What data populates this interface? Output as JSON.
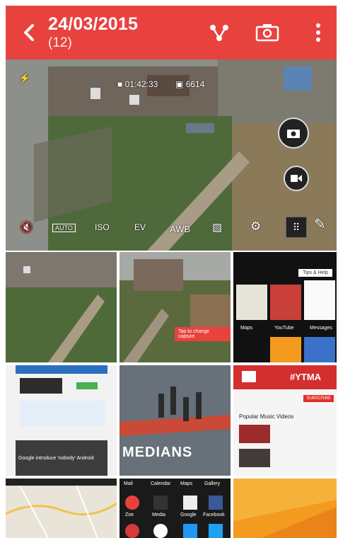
{
  "header": {
    "date": "24/03/2015",
    "count": "(12)",
    "icons": [
      "back-arrow-icon",
      "share-icon",
      "camera-switch-icon",
      "overflow-menu-icon"
    ]
  },
  "camera_hud": {
    "video_time": "01:42:33",
    "photo_count": "6614",
    "settings": [
      "AUTO",
      "ISO",
      "EV",
      "AWB"
    ]
  },
  "thumbnails": {
    "garden_tip": "Tap to change capture",
    "apps": [
      "Maps",
      "YouTube",
      "Messages"
    ],
    "tips": "Tips & Help",
    "ytma_tag": "#YTMA",
    "ytma_section": "Popular Music Videos",
    "subscribe": "SUBSCRIBE",
    "mobiles_headline": "Google introduce 'nobody' Android",
    "dance_caption": "MEDIANS",
    "app_grid": [
      "Mail",
      "Calendar",
      "Maps",
      "Gallery",
      "Zoe",
      "Media",
      "Google",
      "Facebook"
    ]
  },
  "colors": {
    "accent": "#e8423f",
    "youtube": "#e52d27",
    "orange": "#f39a1f"
  }
}
